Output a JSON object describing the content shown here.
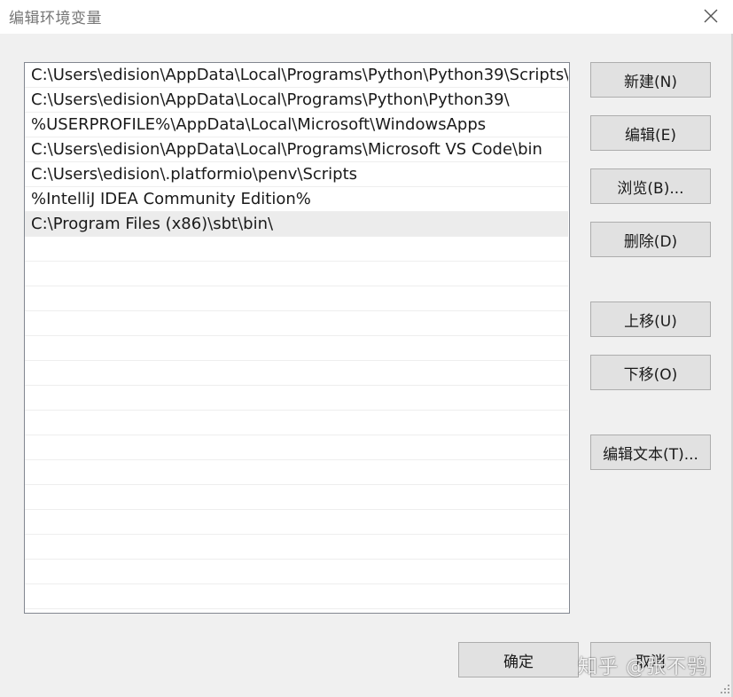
{
  "window": {
    "title": "编辑环境变量"
  },
  "paths": [
    "C:\\Users\\edision\\AppData\\Local\\Programs\\Python\\Python39\\Scripts\\",
    "C:\\Users\\edision\\AppData\\Local\\Programs\\Python\\Python39\\",
    "%USERPROFILE%\\AppData\\Local\\Microsoft\\WindowsApps",
    "C:\\Users\\edision\\AppData\\Local\\Programs\\Microsoft VS Code\\bin",
    "C:\\Users\\edision\\.platformio\\penv\\Scripts",
    "%IntelliJ IDEA Community Edition%",
    "C:\\Program Files (x86)\\sbt\\bin\\"
  ],
  "selected_index": 6,
  "buttons": {
    "new": "新建(N)",
    "edit": "编辑(E)",
    "browse": "浏览(B)...",
    "delete": "删除(D)",
    "move_up": "上移(U)",
    "move_down": "下移(O)",
    "edit_text": "编辑文本(T)...",
    "ok": "确定",
    "cancel": "取消"
  },
  "watermark": "知乎 @张不鸮",
  "icons": {
    "close": "close-icon",
    "grip": "resize-grip-icon"
  }
}
